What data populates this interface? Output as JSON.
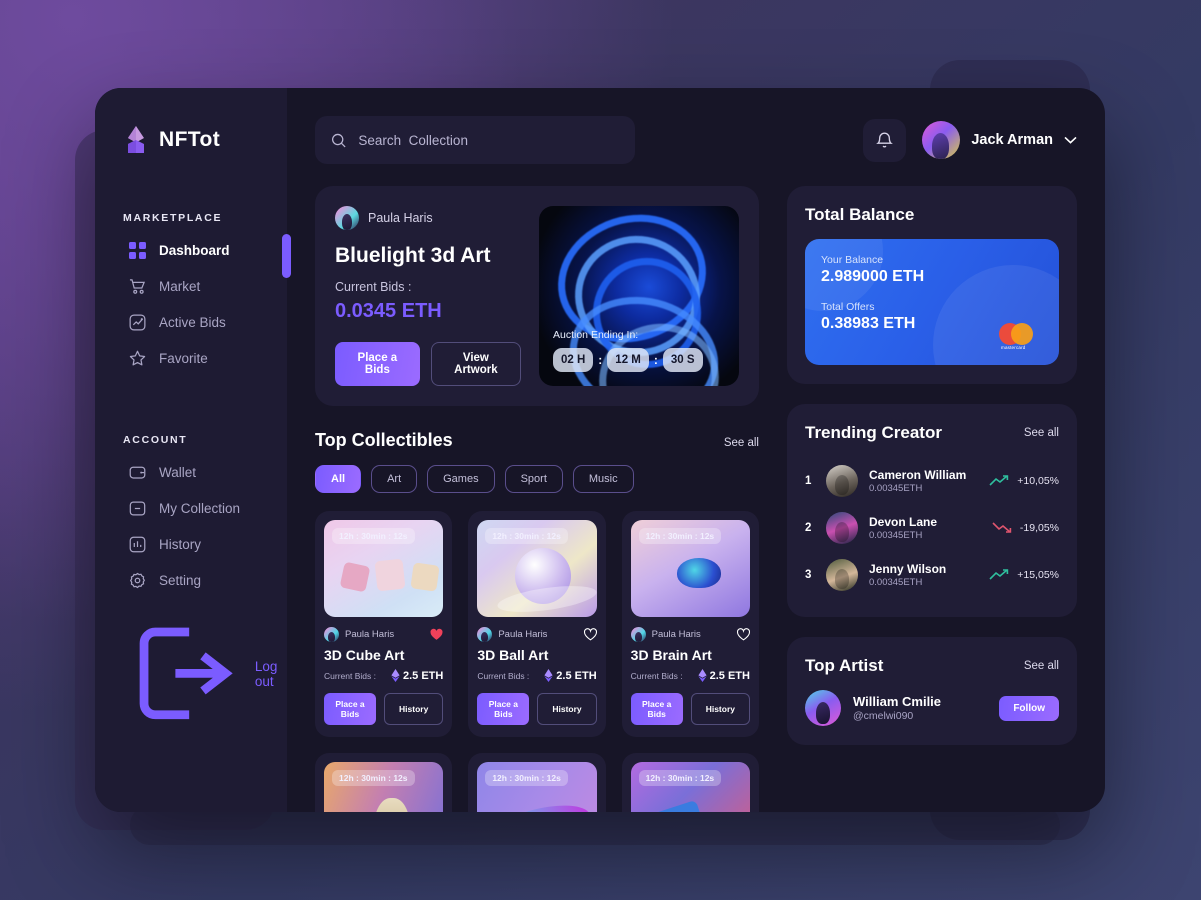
{
  "brand": {
    "name": "NFTot",
    "logo_icon": "ethereum-diamond-icon"
  },
  "sidebar": {
    "groups": [
      {
        "label": "MARKETPLACE",
        "items": [
          {
            "label": "Dashboard",
            "icon": "grid-icon",
            "active": true
          },
          {
            "label": "Market",
            "icon": "cart-icon",
            "active": false
          },
          {
            "label": "Active Bids",
            "icon": "chart-box-icon",
            "active": false
          },
          {
            "label": "Favorite",
            "icon": "star-icon",
            "active": false
          }
        ]
      },
      {
        "label": "ACCOUNT",
        "items": [
          {
            "label": "Wallet",
            "icon": "wallet-icon",
            "active": false
          },
          {
            "label": "My Collection",
            "icon": "minus-box-icon",
            "active": false
          },
          {
            "label": "History",
            "icon": "bar-chart-icon",
            "active": false
          },
          {
            "label": "Setting",
            "icon": "gear-icon",
            "active": false
          }
        ]
      }
    ],
    "logout": {
      "label": "Log out",
      "icon": "logout-icon"
    }
  },
  "topbar": {
    "search": {
      "placeholder": "Search  Collection",
      "value": "",
      "icon": "search-icon"
    },
    "notification_icon": "bell-icon",
    "profile": {
      "name": "Jack Arman",
      "chevron_icon": "chevron-down-icon",
      "avatar_icon": "avatar"
    }
  },
  "featured": {
    "author": "Paula Haris",
    "title": "Bluelight 3d Art",
    "bids_label": "Current Bids :",
    "price": "0.0345 ETH",
    "primary_button": "Place a Bids",
    "secondary_button": "View Artwork",
    "auction_label": "Auction Ending In:",
    "timer": {
      "hours": "02 H",
      "minutes": "12 M",
      "seconds": "30 S",
      "separator": ":"
    }
  },
  "balance": {
    "title": "Total Balance",
    "your_balance_label": "Your Balance",
    "your_balance_value": "2.989000 ETH",
    "total_offers_label": "Total Offers",
    "total_offers_value": "0.38983 ETH",
    "card_brand": "mastercard"
  },
  "collectibles": {
    "title": "Top Collectibles",
    "see_all": "See all",
    "filters": [
      "All",
      "Art",
      "Games",
      "Sport",
      "Music"
    ],
    "active_filter": "All",
    "items": [
      {
        "countdown": "12h : 30min : 12s",
        "author": "Paula Haris",
        "title": "3D Cube Art",
        "bids_label": "Current Bids :",
        "price": "2.5 ETH",
        "liked": true,
        "primary_button": "Place a Bids",
        "secondary_button": "History",
        "art": "art-cube"
      },
      {
        "countdown": "12h : 30min : 12s",
        "author": "Paula Haris",
        "title": "3D Ball Art",
        "bids_label": "Current Bids :",
        "price": "2.5 ETH",
        "liked": false,
        "primary_button": "Place a Bids",
        "secondary_button": "History",
        "art": "art-ball"
      },
      {
        "countdown": "12h : 30min : 12s",
        "author": "Paula Haris",
        "title": "3D Brain Art",
        "bids_label": "Current Bids :",
        "price": "2.5 ETH",
        "liked": false,
        "primary_button": "Place a Bids",
        "secondary_button": "History",
        "art": "art-brain"
      }
    ],
    "items_row2": [
      {
        "countdown": "12h : 30min : 12s",
        "art": "art-tree"
      },
      {
        "countdown": "12h : 30min : 12s",
        "art": "art-wave"
      },
      {
        "countdown": "12h : 30min : 12s",
        "art": "art-geo"
      }
    ]
  },
  "trending": {
    "title": "Trending Creator",
    "see_all": "See all",
    "rows": [
      {
        "rank": "1",
        "name": "Cameron William",
        "amount": "0.00345ETH",
        "change": "+10,05%",
        "direction": "up",
        "color": "#2fbf9e"
      },
      {
        "rank": "2",
        "name": "Devon Lane",
        "amount": "0.00345ETH",
        "change": "-19,05%",
        "direction": "down",
        "color": "#e0556e"
      },
      {
        "rank": "3",
        "name": "Jenny Wilson",
        "amount": "0.00345ETH",
        "change": "+15,05%",
        "direction": "up",
        "color": "#2fbf9e"
      }
    ]
  },
  "top_artist": {
    "title": "Top Artist",
    "see_all": "See all",
    "artist": {
      "name": "William Cmilie",
      "handle": "@cmelwi090",
      "follow_button": "Follow"
    }
  },
  "colors": {
    "accent_purple": "#7b5cff",
    "panel": "#201d36",
    "sidebar": "#1e1b33",
    "window": "#171527",
    "card_blue": "#2f6ff0",
    "up_green": "#2fbf9e",
    "down_red": "#e0556e"
  }
}
